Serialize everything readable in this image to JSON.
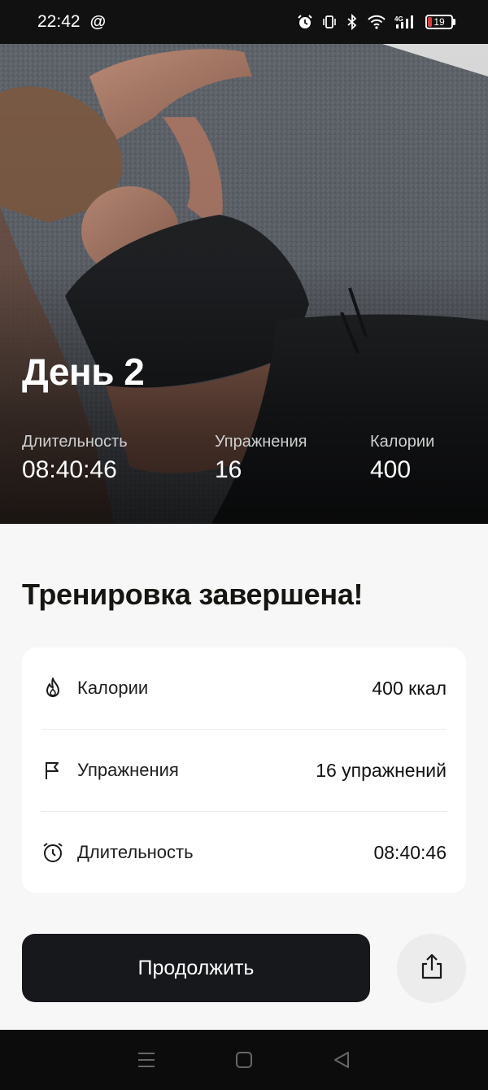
{
  "status_bar": {
    "time": "22:42",
    "at_symbol": "@",
    "battery_level": "19",
    "icons": [
      "alarm-icon",
      "vibrate-icon",
      "bluetooth-icon",
      "wifi-icon",
      "signal-4g-icon",
      "battery-icon"
    ]
  },
  "hero": {
    "title": "День 2",
    "stats": [
      {
        "label": "Длительность",
        "value": "08:40:46"
      },
      {
        "label": "Упражнения",
        "value": "16"
      },
      {
        "label": "Калории",
        "value": "400"
      }
    ]
  },
  "summary": {
    "title": "Тренировка завершена!",
    "rows": [
      {
        "icon": "flame-icon",
        "label": "Калории",
        "value": "400 ккал"
      },
      {
        "icon": "flag-icon",
        "label": "Упражнения",
        "value": "16 упражнений"
      },
      {
        "icon": "alarm-clock-icon",
        "label": "Длительность",
        "value": "08:40:46"
      }
    ]
  },
  "actions": {
    "continue_label": "Продолжить",
    "share_icon": "share-icon"
  },
  "nav": {
    "icons": [
      "menu-icon",
      "home-square-icon",
      "back-triangle-icon"
    ]
  },
  "colors": {
    "accent_dark": "#17181c",
    "battery_low": "#e23a3a",
    "background": "#f7f7f7"
  }
}
